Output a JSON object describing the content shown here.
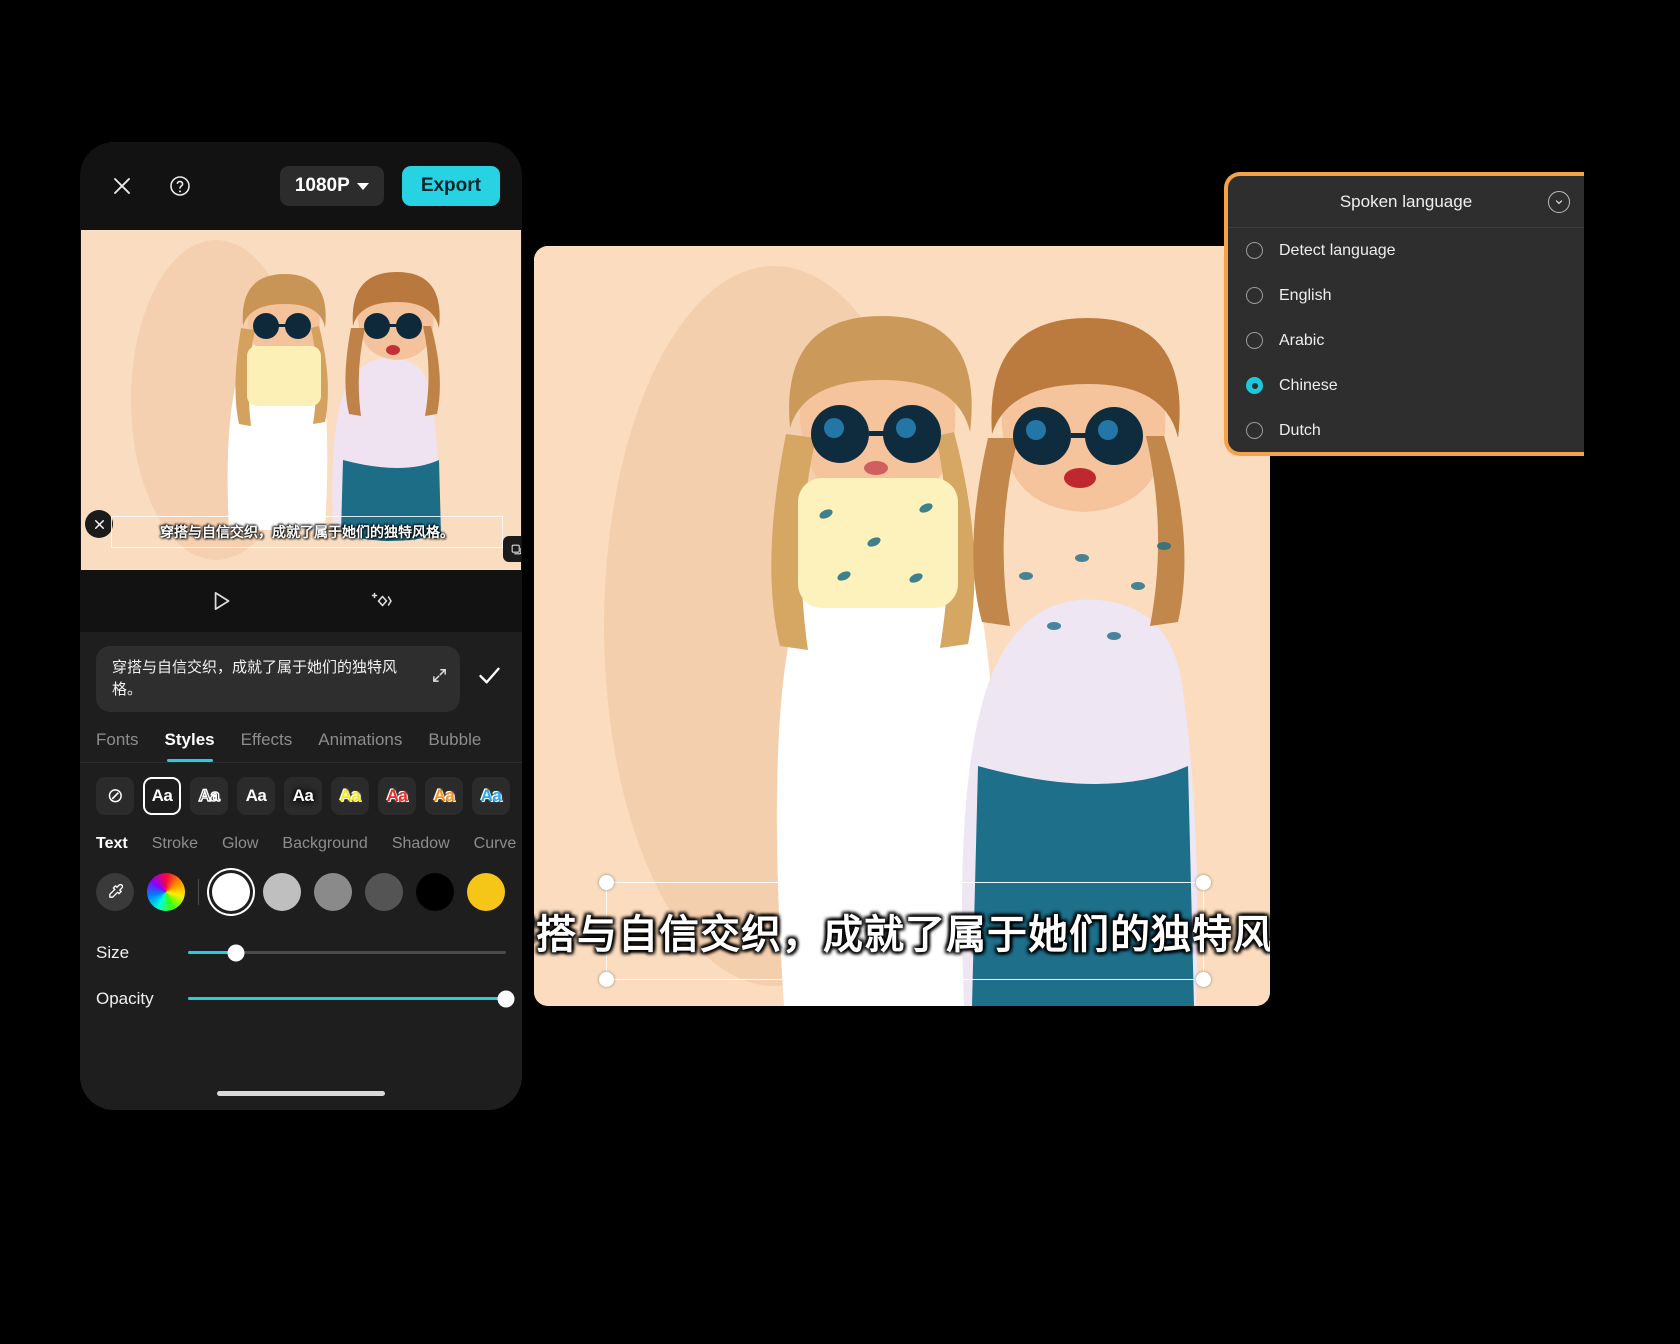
{
  "phone": {
    "topbar": {
      "close_icon": "close-icon",
      "help_icon": "help-icon",
      "resolution": "1080P",
      "export_label": "Export"
    },
    "preview": {
      "subtitle": "穿搭与自信交织，成就了属于她们的独特风格。",
      "close_icon": "close-icon",
      "duplicate_icon": "duplicate-icon"
    },
    "playbar": {
      "play_icon": "play-icon",
      "keyframe_icon": "add-keyframe-icon"
    },
    "editor": {
      "text_value": "穿搭与自信交织，成就了属于她们的独特风格。",
      "expand_icon": "expand-icon",
      "confirm_icon": "check-icon"
    },
    "tabs": [
      {
        "label": "Fonts",
        "active": false
      },
      {
        "label": "Styles",
        "active": true
      },
      {
        "label": "Effects",
        "active": false
      },
      {
        "label": "Animations",
        "active": false
      },
      {
        "label": "Bubble",
        "active": false
      }
    ],
    "presets": [
      {
        "name": "none",
        "glyph": "⊘",
        "color": "#ffffff",
        "selected": false
      },
      {
        "name": "plain-white",
        "glyph": "Aa",
        "color": "#ffffff",
        "selected": true
      },
      {
        "name": "outline",
        "glyph": "Aa",
        "color": "#111111",
        "selected": false
      },
      {
        "name": "white-bold",
        "glyph": "Aa",
        "color": "#ffffff",
        "selected": false
      },
      {
        "name": "white-shadow",
        "glyph": "Aa",
        "color": "#ffffff",
        "selected": false
      },
      {
        "name": "yellow",
        "glyph": "Aa",
        "color": "#f2ea1c",
        "selected": false
      },
      {
        "name": "red",
        "glyph": "Aa",
        "color": "#ef2a2a",
        "selected": false
      },
      {
        "name": "orange",
        "glyph": "Aa",
        "color": "#f79421",
        "selected": false
      },
      {
        "name": "blue",
        "glyph": "Aa",
        "color": "#2aa8f0",
        "selected": false
      }
    ],
    "subtabs": [
      {
        "label": "Text",
        "active": true
      },
      {
        "label": "Stroke",
        "active": false
      },
      {
        "label": "Glow",
        "active": false
      },
      {
        "label": "Background",
        "active": false
      },
      {
        "label": "Shadow",
        "active": false
      },
      {
        "label": "Curve",
        "active": false
      }
    ],
    "swatches": [
      {
        "name": "eyedropper",
        "color": "#3a3a3a",
        "selected": false
      },
      {
        "name": "color-wheel",
        "color": "rainbow",
        "selected": false
      },
      {
        "name": "white",
        "color": "#ffffff",
        "selected": true
      },
      {
        "name": "light-gray",
        "color": "#bfbfbf",
        "selected": false
      },
      {
        "name": "mid-gray",
        "color": "#8a8a8a",
        "selected": false
      },
      {
        "name": "dark-gray",
        "color": "#545454",
        "selected": false
      },
      {
        "name": "black",
        "color": "#000000",
        "selected": false
      },
      {
        "name": "yellow",
        "color": "#f5c518",
        "selected": false
      }
    ],
    "sliders": [
      {
        "label": "Size",
        "value": 15
      },
      {
        "label": "Opacity",
        "value": 100
      }
    ]
  },
  "canvas": {
    "caption": "穿搭与自信交织，成就了属于她们的独特风格"
  },
  "language_panel": {
    "title": "Spoken language",
    "collapse_icon": "chevron-down-icon",
    "accent_color": "#f6a24a",
    "selected_color": "#1ec8dc",
    "options": [
      {
        "label": "Detect language",
        "selected": false
      },
      {
        "label": "English",
        "selected": false
      },
      {
        "label": "Arabic",
        "selected": false
      },
      {
        "label": "Chinese",
        "selected": true
      },
      {
        "label": "Dutch",
        "selected": false
      }
    ]
  }
}
